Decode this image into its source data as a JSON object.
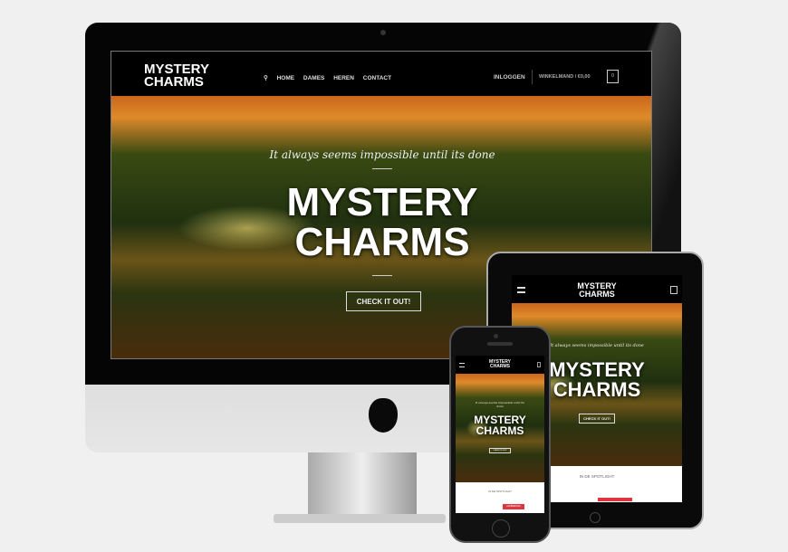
{
  "site": {
    "logo_line1": "MYSTERY",
    "logo_line2": "CHARMS",
    "nav": [
      "HOME",
      "DAMES",
      "HEREN",
      "CONTACT"
    ],
    "login": "INLOGGEN",
    "cart": "WINKELMAND / €0,00",
    "cart_count": "0",
    "tagline": "It always seems impossible until its done",
    "hero_line1": "MYSTERY",
    "hero_line2": "CHARMS",
    "cta": "CHECK IT OUT!",
    "spotlight_tablet": "IN DE SPOTLIGHT",
    "spotlight_phone": "IN DE SPOTLIGHT",
    "badge": "AANBIEDING"
  },
  "colors": {
    "accent": "#e0343f",
    "header": "#000000"
  }
}
